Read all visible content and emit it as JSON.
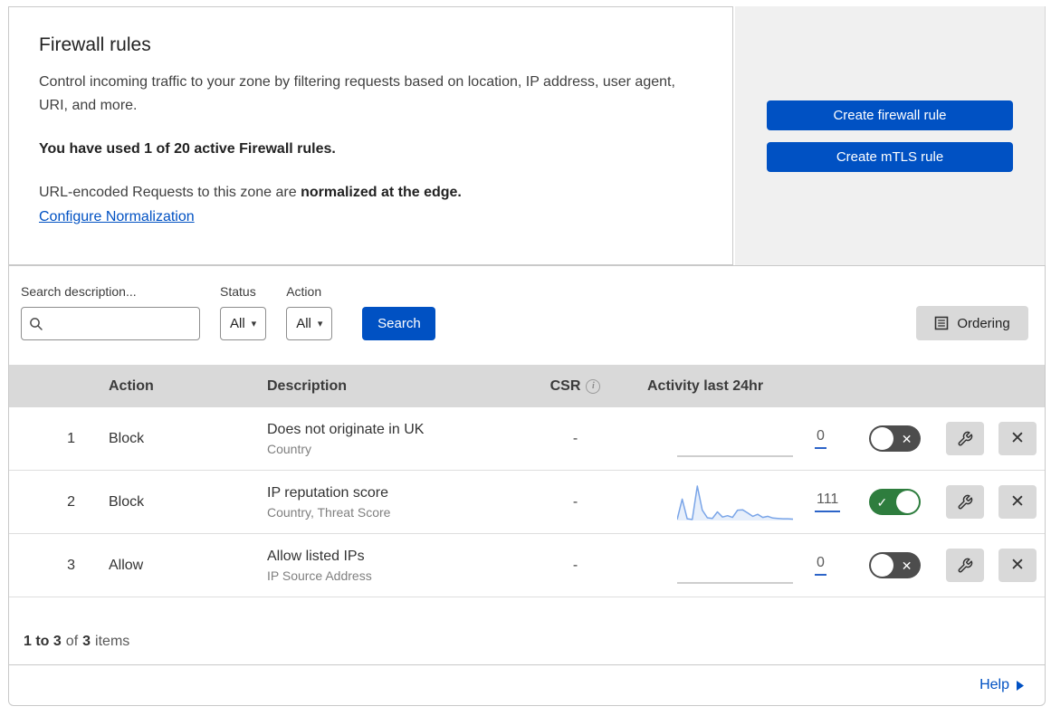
{
  "intro": {
    "title": "Firewall rules",
    "description": "Control incoming traffic to your zone by filtering requests based on location, IP address, user agent, URI, and more.",
    "usage": "You have used 1 of 20 active Firewall rules.",
    "normalization_prefix": "URL-encoded Requests to this zone are ",
    "normalization_bold": "normalized at the edge.",
    "normalization_link": "Configure Normalization"
  },
  "cta": {
    "create_firewall_rule": "Create firewall rule",
    "create_mtls_rule": "Create mTLS rule"
  },
  "filters": {
    "search_label": "Search description...",
    "search_placeholder": "",
    "status_label": "Status",
    "status_value": "All",
    "action_label": "Action",
    "action_value": "All",
    "search_button": "Search",
    "ordering_button": "Ordering"
  },
  "table": {
    "headers": {
      "action": "Action",
      "description": "Description",
      "csr": "CSR",
      "activity": "Activity last 24hr"
    },
    "rows": [
      {
        "index": "1",
        "action": "Block",
        "description": "Does not originate in UK",
        "criteria": "Country",
        "csr": "-",
        "activity_count": "0",
        "enabled": false,
        "sparkline": []
      },
      {
        "index": "2",
        "action": "Block",
        "description": "IP reputation score",
        "criteria": "Country, Threat Score",
        "csr": "-",
        "activity_count": "111",
        "enabled": true,
        "sparkline": [
          3,
          62,
          5,
          3,
          100,
          30,
          8,
          6,
          25,
          10,
          14,
          9,
          30,
          31,
          22,
          12,
          18,
          9,
          12,
          7,
          6,
          5,
          5,
          4
        ]
      },
      {
        "index": "3",
        "action": "Allow",
        "description": "Allow listed IPs",
        "criteria": "IP Source Address",
        "csr": "-",
        "activity_count": "0",
        "enabled": false,
        "sparkline": []
      }
    ]
  },
  "footer": {
    "range": "1 to 3",
    "of": "of",
    "total": "3",
    "items": "items",
    "help": "Help"
  },
  "colors": {
    "primary_blue": "#0051c3",
    "link_blue": "#0051c3",
    "toggle_on_green": "#2e7d3e",
    "toggle_off_gray": "#4d4d4d",
    "sparkline_blue": "#7aa5e8",
    "sparkline_flat_gray": "#bdbdbd",
    "table_header_gray": "#d9d9d9"
  }
}
